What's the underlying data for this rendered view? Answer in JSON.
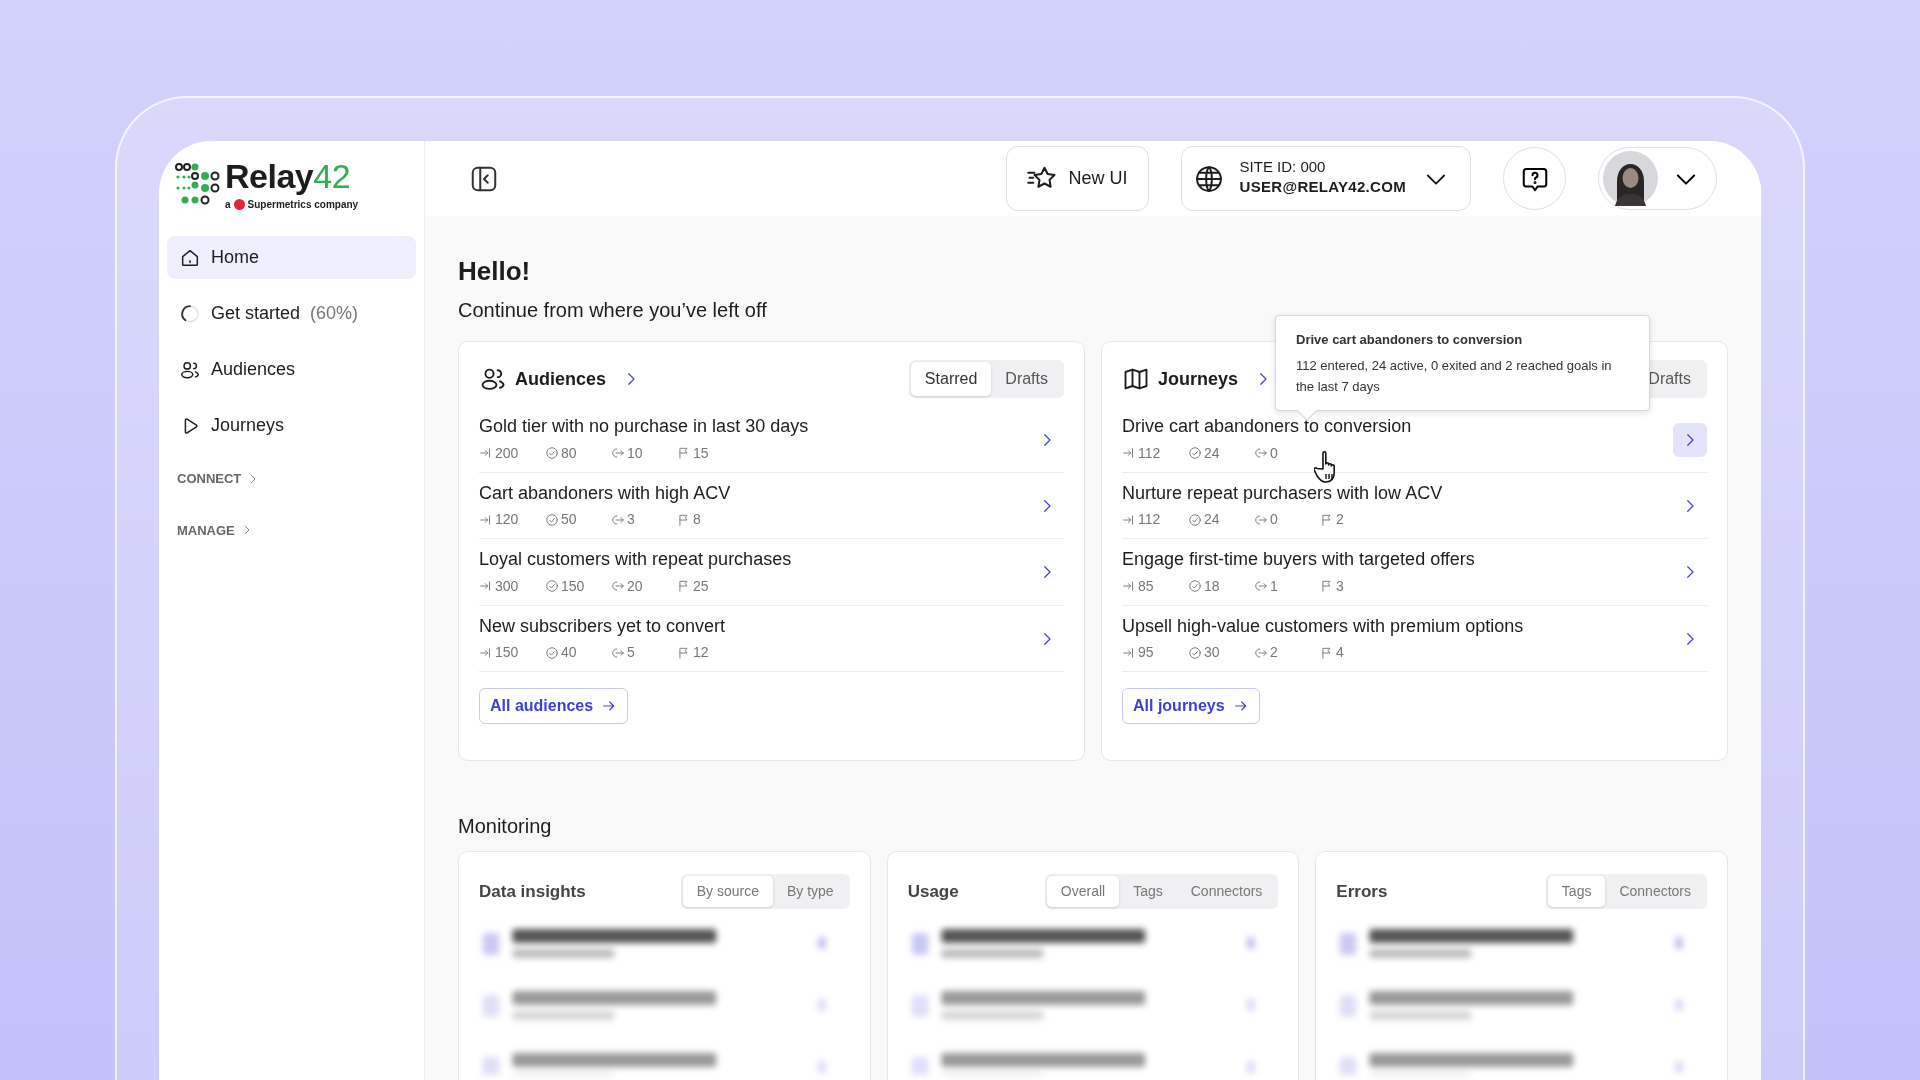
{
  "sidebar": {
    "logo": {
      "wordmark": "Relay",
      "wordmark_accent": "42",
      "tagline_prefix": "a",
      "tagline": "Supermetrics company"
    },
    "items": [
      {
        "kind": "home",
        "label": "Home",
        "selected": true
      },
      {
        "kind": "progress",
        "label": "Get started",
        "suffix": "(60%)",
        "selected": false
      },
      {
        "kind": "audiences",
        "label": "Audiences",
        "selected": false
      },
      {
        "kind": "journeys",
        "label": "Journeys",
        "selected": false
      }
    ],
    "sections": [
      {
        "label": "CONNECT",
        "expanded": false
      },
      {
        "label": "MANAGE",
        "expanded": false
      }
    ]
  },
  "header": {
    "new_ui": "New UI",
    "site": {
      "id": "SITE ID: 000",
      "user": "USER@RELAY42.COM"
    }
  },
  "greeting": "Hello!",
  "subtitle": "Continue from where you’ve left off",
  "panels": [
    {
      "kind": "audiences",
      "title": "Audiences",
      "tabs": [
        {
          "label": "Starred",
          "selected": true
        },
        {
          "label": "Drafts",
          "selected": false
        }
      ],
      "rows": [
        {
          "title": "Gold tier with no purchase in last 30 days",
          "entered": "200",
          "active": "80",
          "exited": "10",
          "goals": "15",
          "hovered": false
        },
        {
          "title": "Cart abandoners with high ACV",
          "entered": "120",
          "active": "50",
          "exited": "3",
          "goals": "8",
          "hovered": false
        },
        {
          "title": "Loyal customers with repeat purchases",
          "entered": "300",
          "active": "150",
          "exited": "20",
          "goals": "25",
          "hovered": false
        },
        {
          "title": "New subscribers yet to convert",
          "entered": "150",
          "active": "40",
          "exited": "5",
          "goals": "12",
          "hovered": false
        }
      ],
      "link": "All audiences"
    },
    {
      "kind": "journeys",
      "title": "Journeys",
      "tabs": [
        {
          "label": "Drafts",
          "selected": false
        }
      ],
      "rows": [
        {
          "title": "Drive cart abandoners to conversion",
          "entered": "112",
          "active": "24",
          "exited": "0",
          "hovered": true
        },
        {
          "title": "Nurture repeat purchasers with low ACV",
          "entered": "112",
          "active": "24",
          "exited": "0",
          "goals": "2",
          "hovered": false
        },
        {
          "title": "Engage first-time buyers with targeted offers",
          "entered": "85",
          "active": "18",
          "exited": "1",
          "goals": "3",
          "hovered": false
        },
        {
          "title": "Upsell high-value customers with premium options",
          "entered": "95",
          "active": "30",
          "exited": "2",
          "goals": "4",
          "hovered": false
        }
      ],
      "link": "All journeys",
      "tooltip": {
        "title": "Drive cart abandoners to conversion",
        "text": "112 entered, 24 active, 0 exited and 2 reached goals in the last 7 days"
      }
    }
  ],
  "monitoring": {
    "title": "Monitoring",
    "panels": [
      {
        "title": "Data insights",
        "tabs": [
          {
            "label": "By source",
            "selected": true
          },
          {
            "label": "By type",
            "selected": false
          }
        ]
      },
      {
        "title": "Usage",
        "tabs": [
          {
            "label": "Overall",
            "selected": true
          },
          {
            "label": "Tags",
            "selected": false
          },
          {
            "label": "Connectors",
            "selected": false
          }
        ]
      },
      {
        "title": "Errors",
        "tabs": [
          {
            "label": "Tags",
            "selected": true
          },
          {
            "label": "Connectors",
            "selected": false
          }
        ]
      }
    ]
  }
}
